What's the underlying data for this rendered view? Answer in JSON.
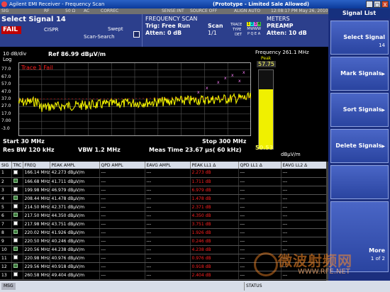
{
  "window": {
    "title": "Agilent EMI Receiver - Frequency Scan",
    "banner": "(Prototype - Limited Sale Allowed)",
    "buttons": [
      "_",
      "□",
      "X"
    ]
  },
  "status_strip": {
    "sig": "SIG",
    "rf": "RF",
    "impedance": "50 Ω",
    "coupling": "AC",
    "correc": "CORREC",
    "sense": "SENSE:INT",
    "source": "SOURCE OFF",
    "align": "ALIGN AUTO",
    "datetime": "12:08:17 PM May 26, 2010"
  },
  "header": {
    "selected_signal": "Select Signal  14",
    "fail": "FAIL",
    "standard": "CISPR",
    "swept": "Swept",
    "scan_search": "Scan-Search",
    "mode": "FREQUENCY SCAN",
    "trig": "Trig: Free Run",
    "atten": "Atten: 0 dB",
    "scan_label": "Scan",
    "scan_value": "1/1",
    "trace_label": "TRACE",
    "type_label": "TYPE",
    "det_label": "DET",
    "trace_nums": [
      "1",
      "2",
      "3",
      "4"
    ],
    "type_vals": [
      "M",
      "W",
      "W",
      "W"
    ],
    "det_vals": [
      "P",
      "Q",
      "E",
      "A"
    ],
    "meters": "METERS",
    "preamp": "PREAMP",
    "meter_atten": "Atten: 10 dB"
  },
  "plot": {
    "scale": "10 dB/div",
    "log": "Log",
    "ref": "Ref 86.99 dBµV/m",
    "trace_fail": "Trace 1 Fail",
    "y_ticks": [
      "77.0",
      "67.0",
      "57.0",
      "47.0",
      "37.0",
      "27.0",
      "17.0",
      "7.00",
      "-3.0"
    ],
    "start": "Start 30 MHz",
    "stop": "Stop 300 MHz",
    "res_bw": "Res BW 120 kHz",
    "vbw": "VBW 1.2 MHz",
    "meas_time": "Meas Time 23.67 µs( 60 kHz)",
    "limit_color": "#ff2020",
    "trace_color": "#f0f000"
  },
  "meter": {
    "frequency": "Frequency  261.1 MHz",
    "mode": "Peak",
    "peak_value": "57.75",
    "current_value": "50.53",
    "unit": "dBµV/m",
    "bar_fill": 0.76,
    "bar_color": "#f0f000"
  },
  "table": {
    "headers": [
      "SIG",
      "TRC",
      "FREQ",
      "PEAK AMPL",
      "QPD AMPL",
      "EAVG AMPL",
      "PEAK LL1 Δ",
      "QPD LL1 Δ",
      "EAVG LL2 Δ"
    ],
    "rows": [
      {
        "sig": "1",
        "freq": "166.14 MHz",
        "peak": "42.273 dBµV/m",
        "qpd": "---",
        "eavg": "---",
        "pll1": "2.273 dB",
        "qll1": "---",
        "ell2": "---"
      },
      {
        "sig": "2",
        "freq": "166.68 MHz",
        "peak": "41.711 dBµV/m",
        "qpd": "---",
        "eavg": "---",
        "pll1": "1.711 dB",
        "qll1": "---",
        "ell2": "---"
      },
      {
        "sig": "3",
        "freq": "199.98 MHz",
        "peak": "46.979 dBµV/m",
        "qpd": "---",
        "eavg": "---",
        "pll1": "6.979 dB",
        "qll1": "---",
        "ell2": "---"
      },
      {
        "sig": "4",
        "freq": "208.44 MHz",
        "peak": "41.478 dBµV/m",
        "qpd": "---",
        "eavg": "---",
        "pll1": "1.478 dB",
        "qll1": "---",
        "ell2": "---"
      },
      {
        "sig": "5",
        "freq": "214.50 MHz",
        "peak": "42.371 dBµV/m",
        "qpd": "---",
        "eavg": "---",
        "pll1": "2.371 dB",
        "qll1": "---",
        "ell2": "---"
      },
      {
        "sig": "6",
        "freq": "217.50 MHz",
        "peak": "44.350 dBµV/m",
        "qpd": "---",
        "eavg": "---",
        "pll1": "4.350 dB",
        "qll1": "---",
        "ell2": "---"
      },
      {
        "sig": "7",
        "freq": "217.98 MHz",
        "peak": "43.751 dBµV/m",
        "qpd": "---",
        "eavg": "---",
        "pll1": "3.751 dB",
        "qll1": "---",
        "ell2": "---"
      },
      {
        "sig": "8",
        "freq": "220.02 MHz",
        "peak": "41.926 dBµV/m",
        "qpd": "---",
        "eavg": "---",
        "pll1": "1.926 dB",
        "qll1": "---",
        "ell2": "---"
      },
      {
        "sig": "9",
        "freq": "220.50 MHz",
        "peak": "40.246 dBµV/m",
        "qpd": "---",
        "eavg": "---",
        "pll1": "0.246 dB",
        "qll1": "---",
        "ell2": "---"
      },
      {
        "sig": "10",
        "freq": "220.56 MHz",
        "peak": "44.238 dBµV/m",
        "qpd": "---",
        "eavg": "---",
        "pll1": "4.238 dB",
        "qll1": "---",
        "ell2": "---"
      },
      {
        "sig": "11",
        "freq": "220.98 MHz",
        "peak": "40.976 dBµV/m",
        "qpd": "---",
        "eavg": "---",
        "pll1": "0.976 dB",
        "qll1": "---",
        "ell2": "---"
      },
      {
        "sig": "12",
        "freq": "229.56 MHz",
        "peak": "40.918 dBµV/m",
        "qpd": "---",
        "eavg": "---",
        "pll1": "0.918 dB",
        "qll1": "---",
        "ell2": "---"
      },
      {
        "sig": "13",
        "freq": "260.58 MHz",
        "peak": "49.404 dBµV/m",
        "qpd": "---",
        "eavg": "---",
        "pll1": "2.404 dB",
        "qll1": "---",
        "ell2": "---"
      }
    ]
  },
  "softkeys": {
    "title": "Signal List",
    "items": [
      {
        "label": "Select Signal",
        "value": "14"
      },
      {
        "label": "Mark Signals",
        "value": ""
      },
      {
        "label": "Sort Signals",
        "value": ""
      },
      {
        "label": "Delete Signals",
        "value": ""
      },
      {
        "label": "",
        "value": ""
      },
      {
        "label": "More",
        "value": "1 of 2"
      }
    ]
  },
  "bottom": {
    "msg": "MSG",
    "status": "STATUS"
  },
  "watermark": {
    "text": "微波射频网",
    "url": "WWW.RFE.NET"
  }
}
